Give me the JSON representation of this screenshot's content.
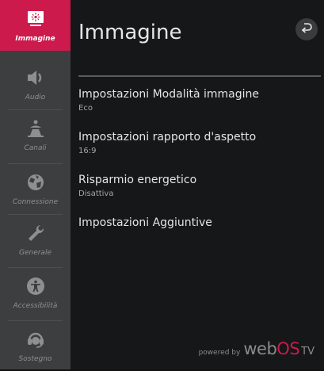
{
  "sidebar": {
    "items": [
      {
        "label": "Immagine",
        "icon": "picture-icon",
        "active": true
      },
      {
        "label": "Audio",
        "icon": "speaker-icon",
        "active": false
      },
      {
        "label": "Canali",
        "icon": "antenna-icon",
        "active": false
      },
      {
        "label": "Connessione",
        "icon": "globe-icon",
        "active": false
      },
      {
        "label": "Generale",
        "icon": "wrench-icon",
        "active": false
      },
      {
        "label": "Accessibilità",
        "icon": "accessibility-icon",
        "active": false
      },
      {
        "label": "Sostegno",
        "icon": "support-icon",
        "active": false
      }
    ]
  },
  "header": {
    "title": "Immagine",
    "back_icon": "back-arrow-icon"
  },
  "menu": [
    {
      "label": "Impostazioni Modalità immagine",
      "value": "Eco"
    },
    {
      "label": "Impostazioni rapporto d'aspetto",
      "value": "16:9"
    },
    {
      "label": "Risparmio energetico",
      "value": "Disattiva"
    },
    {
      "label": "Impostazioni Aggiuntive",
      "value": ""
    }
  ],
  "footer": {
    "powered_by": "powered by",
    "brand_web": "web",
    "brand_os": "OS",
    "brand_tv": "TV"
  },
  "colors": {
    "accent": "#cc1a4d",
    "sidebar_bg": "#3d3e40",
    "main_bg": "#161718"
  }
}
